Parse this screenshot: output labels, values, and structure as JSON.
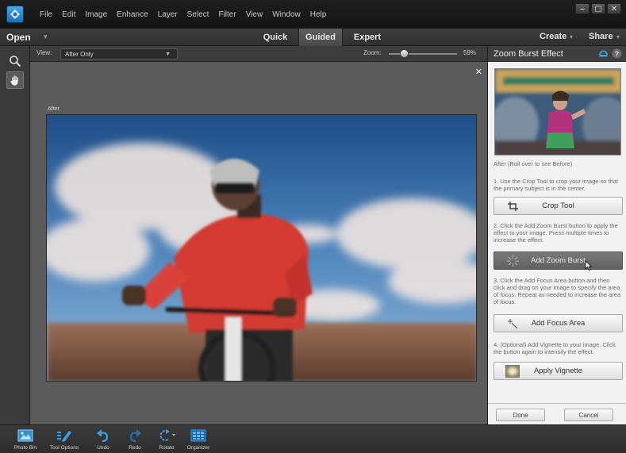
{
  "menu": [
    "File",
    "Edit",
    "Image",
    "Enhance",
    "Layer",
    "Select",
    "Filter",
    "View",
    "Window",
    "Help"
  ],
  "window_controls": {
    "minimize": "–",
    "restore": "▢",
    "close": "✕"
  },
  "modebar": {
    "open": "Open",
    "open_arrow": "▾",
    "tabs": [
      "Quick",
      "Guided",
      "Expert"
    ],
    "active_tab": "Guided",
    "create": "Create",
    "create_arrow": "▾",
    "share": "Share",
    "share_arrow": "▾"
  },
  "optbar": {
    "view_label": "View:",
    "view_value": "After Only",
    "view_caret": "▼",
    "zoom_label": "Zoom:",
    "zoom_value": "59%",
    "zoom_level_percent": 59
  },
  "canvas": {
    "close": "✕",
    "after_label": "After"
  },
  "panel": {
    "title": "Zoom Burst Effect",
    "thumb_caption": "After (Roll over to see Before)",
    "step1": "1. Use the Crop Tool to crop your image so that the primary subject is in the center.",
    "crop_button": "Crop Tool",
    "step2": "2. Click the Add Zoom Burst button to apply the effect to your image. Press multiple times to increase the effect.",
    "zoom_burst_button": "Add Zoom Burst",
    "step3": "3. Click the Add Focus Area button and then click and drag on your image to specify the area of focus. Repeat as needed to increase the area of focus.",
    "focus_button": "Add Focus Area",
    "step4": "4. (Optional) Add Vignette to your image. Click the button again to intensify the effect.",
    "vignette_button": "Apply Vignette",
    "done": "Done",
    "cancel": "Cancel"
  },
  "taskbar": [
    {
      "label": "Photo Bin",
      "icon": "photo-bin-icon"
    },
    {
      "label": "Tool Options",
      "icon": "tool-options-icon"
    },
    {
      "label": "Undo",
      "icon": "undo-icon"
    },
    {
      "label": "Redo",
      "icon": "redo-icon"
    },
    {
      "label": "Rotate",
      "icon": "rotate-icon"
    },
    {
      "label": "Organizer",
      "icon": "organizer-icon"
    }
  ],
  "colors": {
    "accent_blue": "#2f8fd8",
    "panel_bg": "#f2f2f2",
    "canvas_bg": "#5b5b5b"
  }
}
